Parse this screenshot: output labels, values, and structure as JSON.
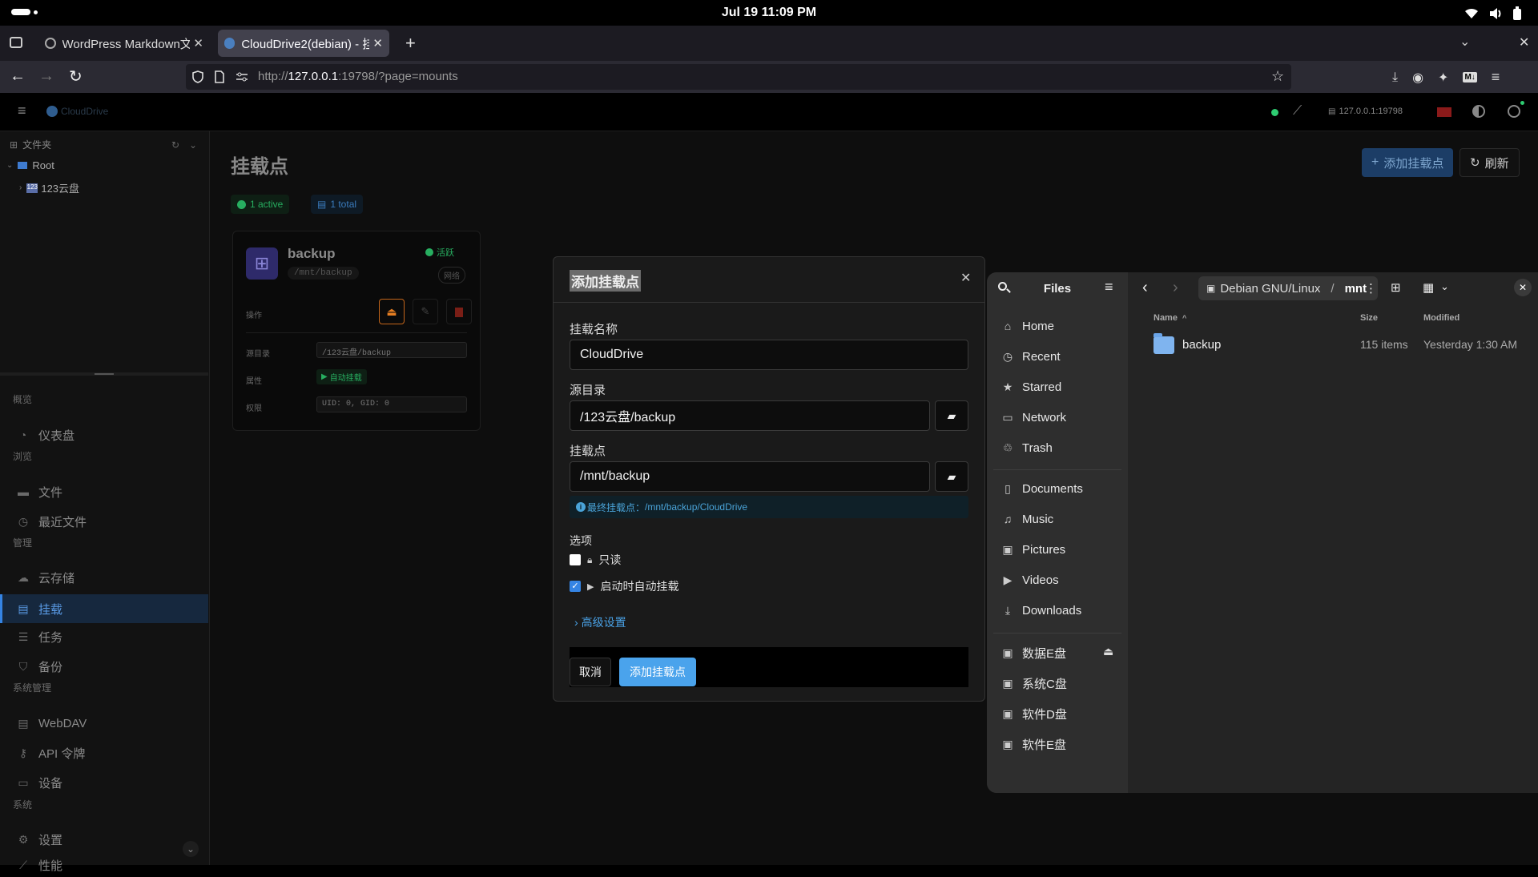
{
  "system": {
    "clock": "Jul 19  11:09 PM"
  },
  "browser": {
    "tabs": [
      {
        "label": "WordPress Markdown文",
        "active": false
      },
      {
        "label": "CloudDrive2(debian) - 挂",
        "active": true
      }
    ],
    "url_prefix": "http://",
    "url_host": "127.0.0.1",
    "url_rest": ":19798/?page=mounts"
  },
  "app": {
    "logo": "CloudDrive",
    "server": "127.0.0.1:19798",
    "sidebar": {
      "tree_title": "文件夹",
      "tree_root": "Root",
      "tree_child": "123云盘",
      "sections": [
        {
          "title": "概览",
          "items": [
            {
              "label": "仪表盘"
            }
          ]
        },
        {
          "title": "浏览",
          "items": [
            {
              "label": "文件"
            },
            {
              "label": "最近文件"
            }
          ]
        },
        {
          "title": "管理",
          "items": [
            {
              "label": "云存储"
            },
            {
              "label": "挂载"
            },
            {
              "label": "任务"
            },
            {
              "label": "备份"
            }
          ]
        },
        {
          "title": "系统管理",
          "items": [
            {
              "label": "WebDAV"
            },
            {
              "label": "API 令牌"
            },
            {
              "label": "设备"
            }
          ]
        },
        {
          "title": "系统",
          "items": [
            {
              "label": "设置"
            },
            {
              "label": "性能"
            }
          ]
        }
      ]
    },
    "page": {
      "title": "挂载点",
      "active_badge": "1 active",
      "total_badge": "1 total",
      "add_button": "添加挂载点",
      "refresh_button": "刷新"
    },
    "mount_card": {
      "name": "backup",
      "path": "/mnt/backup",
      "status": "活跃",
      "type": "网络",
      "ops_label": "操作",
      "source_label": "源目录",
      "source_value": "/123云盘/backup",
      "attr_label": "属性",
      "attr_value": "自动挂载",
      "perm_label": "权限",
      "perm_value": "UID: 0, GID: 0"
    }
  },
  "dialog": {
    "title": "添加挂载点",
    "name_label": "挂载名称",
    "name_value": "CloudDrive",
    "source_label": "源目录",
    "source_value": "/123云盘/backup",
    "mount_label": "挂载点",
    "mount_value": "/mnt/backup",
    "final_hint": "最终挂载点：",
    "final_path": "/mnt/backup/CloudDrive",
    "options_label": "选项",
    "readonly_label": "只读",
    "readonly_checked": false,
    "autostart_label": "启动时自动挂载",
    "autostart_checked": true,
    "advanced_label": "高级设置",
    "cancel": "取消",
    "submit": "添加挂载点"
  },
  "files": {
    "title": "Files",
    "breadcrumb_root": "Debian GNU/Linux",
    "breadcrumb_sep": "/",
    "breadcrumb_current": "mnt",
    "places": [
      "Home",
      "Recent",
      "Starred",
      "Network",
      "Trash"
    ],
    "bookmarks": [
      "Documents",
      "Music",
      "Pictures",
      "Videos",
      "Downloads"
    ],
    "drives": [
      "数据E盘",
      "系统C盘",
      "软件D盘",
      "软件E盘"
    ],
    "columns": {
      "name": "Name",
      "size": "Size",
      "modified": "Modified"
    },
    "rows": [
      {
        "name": "backup",
        "size": "115 items",
        "modified": "Yesterday 1:30 AM"
      }
    ]
  },
  "colors": {
    "accent": "#3584e4",
    "active_green": "#2ecc71",
    "danger": "#c0392b",
    "warning": "#e67e22"
  }
}
